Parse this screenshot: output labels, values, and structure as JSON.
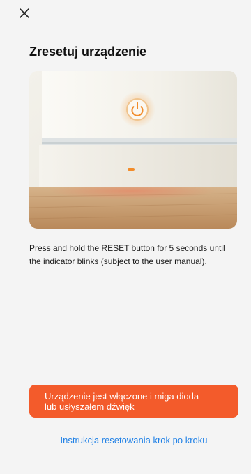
{
  "header": {
    "close_icon": "close-icon"
  },
  "title": "Zresetuj urządzenie",
  "hero": {
    "icon": "power-icon",
    "accent": "#f28c2a"
  },
  "instructions": "Press and hold the RESET button for 5 seconds until the indicator blinks (subject to the user manual).",
  "primary_button": {
    "label": "Urządzenie jest włączone i miga dioda\nlub usłyszałem dźwięk",
    "color": "#f35b2b"
  },
  "help_link": "Instrukcja resetowania krok po kroku",
  "colors": {
    "background": "#f4f4f4",
    "link": "#1f80e6"
  }
}
